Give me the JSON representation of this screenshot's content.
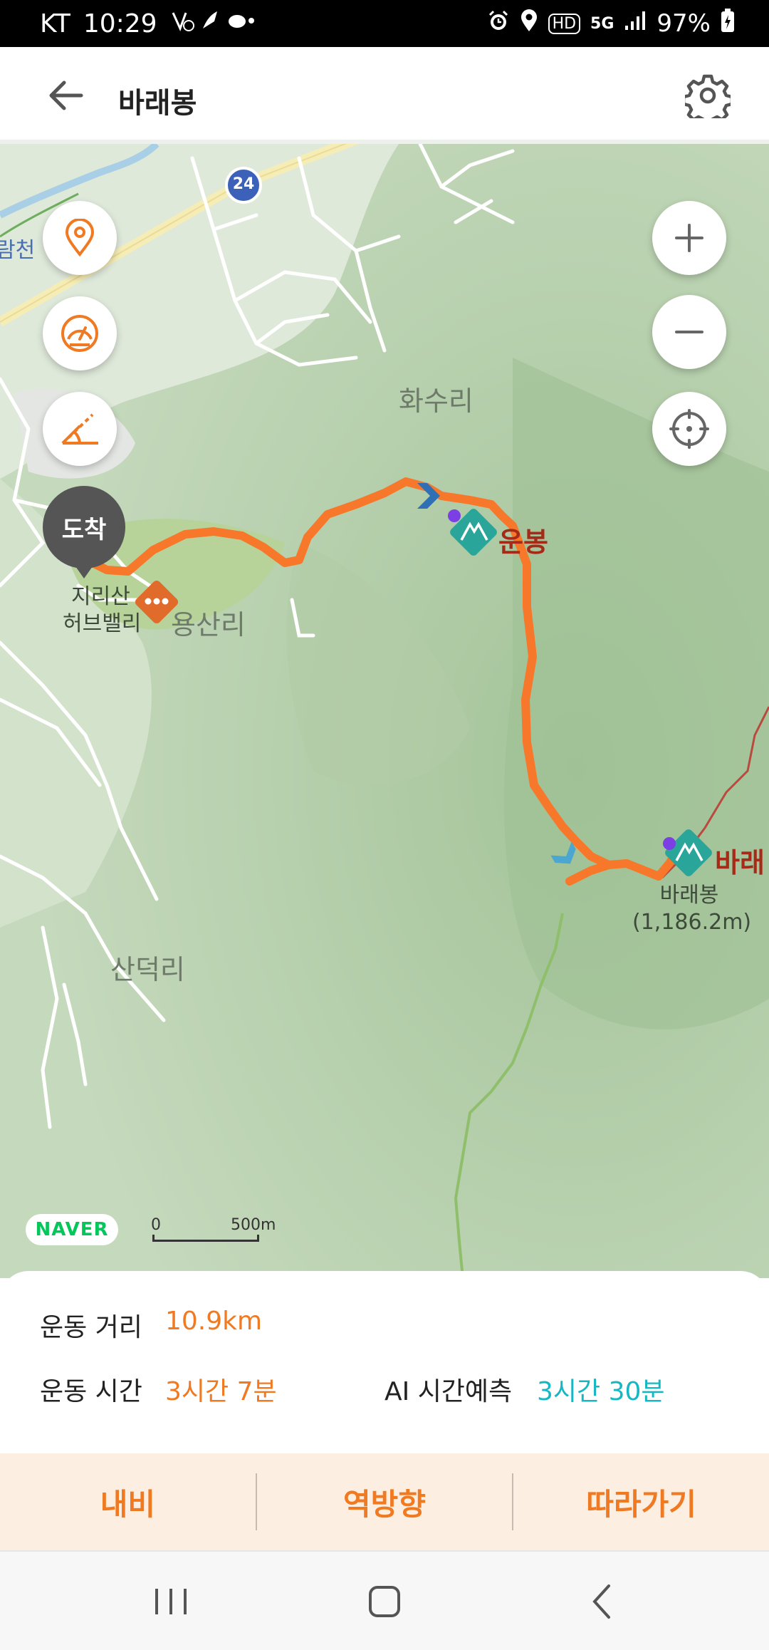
{
  "status_bar": {
    "carrier": "KT",
    "time": "10:29",
    "hd": "HD",
    "network": "5G",
    "battery": "97%"
  },
  "header": {
    "title": "바래봉"
  },
  "map": {
    "place_labels": {
      "hwasu": "화수리",
      "yongsan": "용산리",
      "sandeok": "산덕리",
      "stream": "람천",
      "herb_top": "지리산",
      "herb_bottom": "허브밸리"
    },
    "road_badge": "24",
    "arrival_marker": "도착",
    "peaks": {
      "unbong": {
        "name": "운봉"
      },
      "baraebong": {
        "name": "바래",
        "sub_name": "바래봉",
        "elevation": "(1,186.2m)"
      }
    },
    "naver_logo": "NAVER",
    "scale": {
      "zero": "0",
      "distance": "500m"
    }
  },
  "summary": {
    "distance_label": "운동 거리",
    "distance_value": "10.9km",
    "time_label": "운동 시간",
    "time_value": "3시간 7분",
    "ai_label": "AI 시간예측",
    "ai_value": "3시간 30분"
  },
  "actions": {
    "navi": "내비",
    "reverse": "역방향",
    "follow": "따라가기"
  },
  "colors": {
    "route": "#f7782a",
    "accent_orange": "#f07a22",
    "accent_teal": "#15b8c2",
    "peak_marker": "#2aa59a"
  }
}
